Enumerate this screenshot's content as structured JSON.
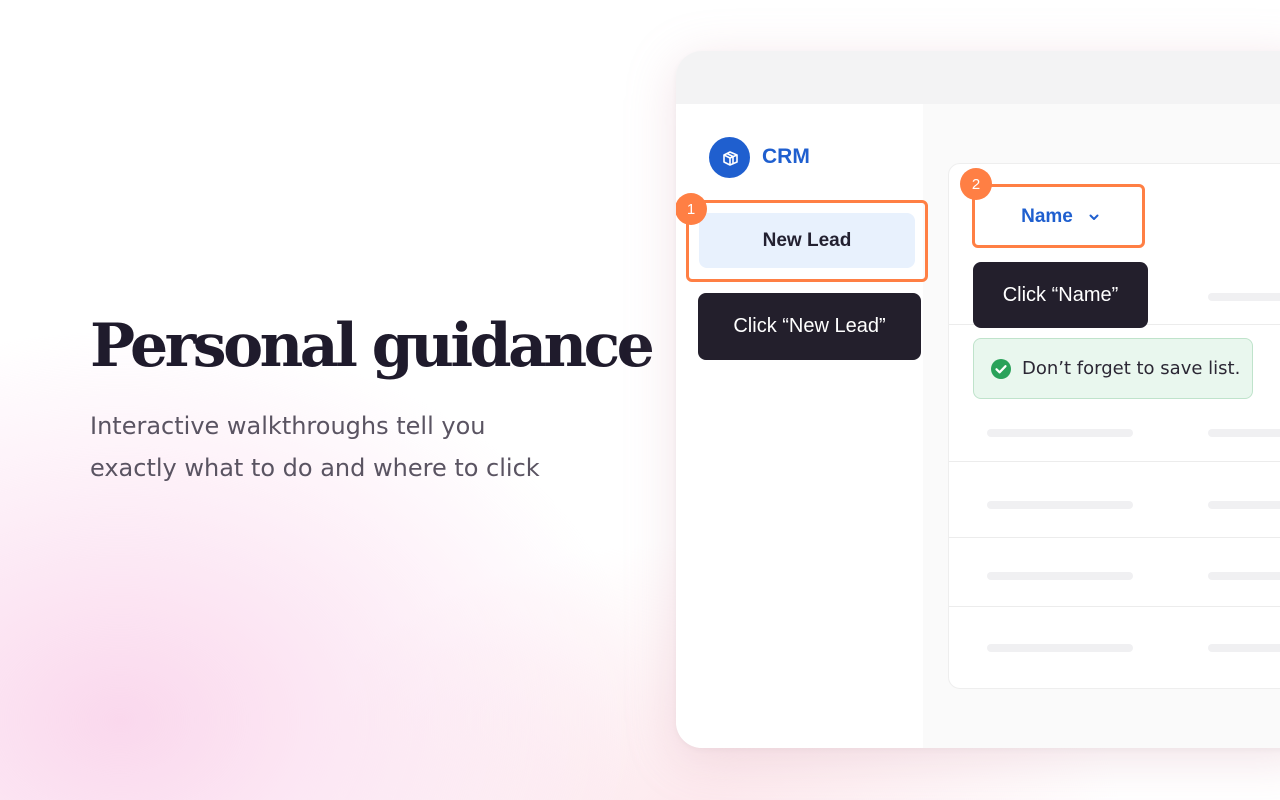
{
  "hero": {
    "title": "Personal guidance",
    "subtitle": "Interactive walkthroughs tell you exactly what to do and where to click"
  },
  "app": {
    "logo_icon": "cube-icon",
    "brand": "CRM",
    "new_lead_label": "New Lead",
    "column_header": "Name",
    "column_header_icon": "chevron-down-icon"
  },
  "walkthrough": {
    "step1": {
      "number": "1",
      "tooltip": "Click “New Lead”"
    },
    "step2": {
      "number": "2",
      "tooltip": "Click “Name”"
    },
    "toast": {
      "icon": "check-circle-icon",
      "message": "Don’t forget to save list."
    }
  },
  "colors": {
    "brand_blue": "#1f5fcf",
    "highlight_orange": "#ff7f44",
    "tooltip_dark": "#231f2c",
    "success_green": "#2aa25a"
  }
}
